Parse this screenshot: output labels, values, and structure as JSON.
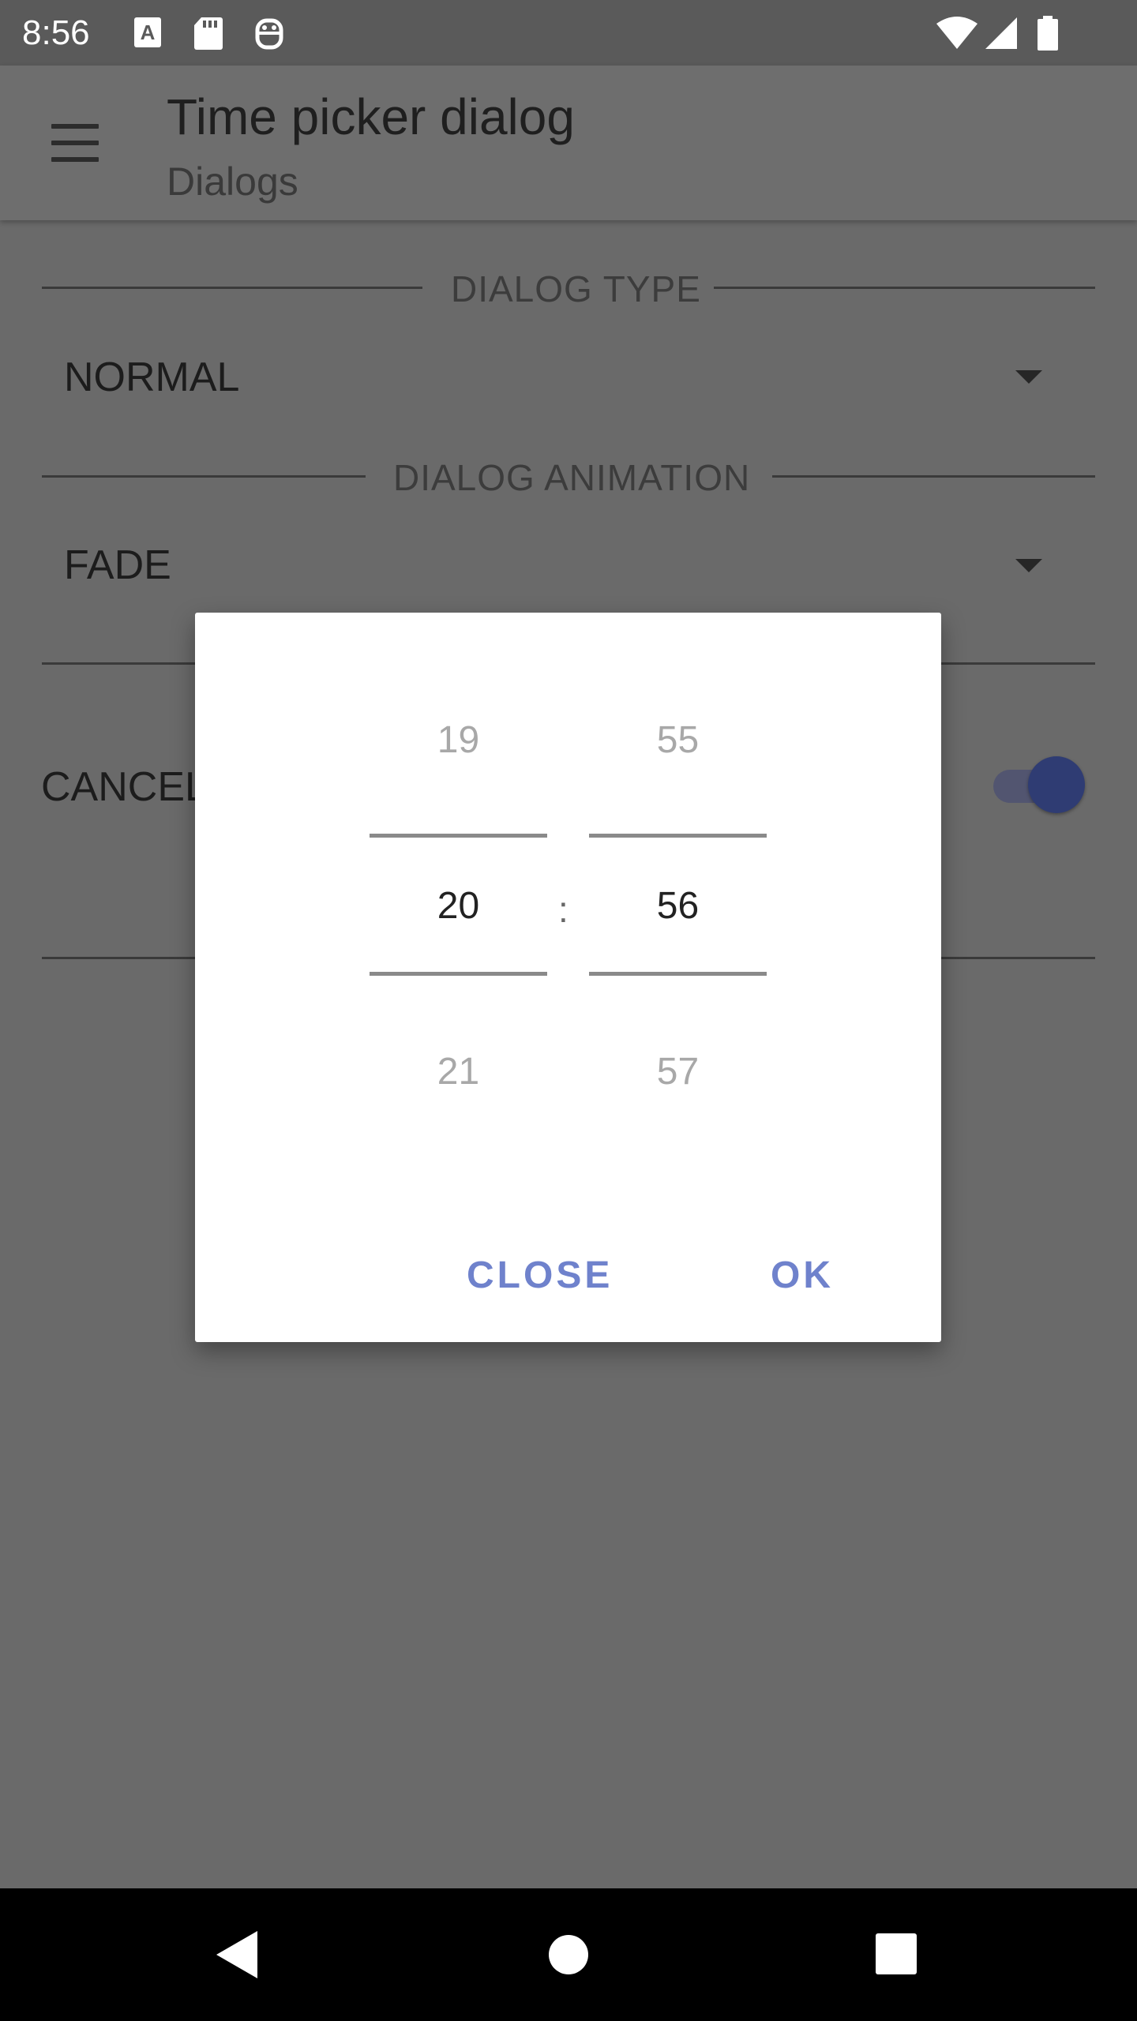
{
  "status_bar": {
    "time": "8:56",
    "icons": [
      "a-notification-icon",
      "sd-card-icon",
      "robot-icon",
      "wifi-icon",
      "signal-icon",
      "battery-icon"
    ]
  },
  "app_bar": {
    "menu_icon": "menu-icon",
    "title": "Time picker dialog",
    "subtitle": "Dialogs"
  },
  "form": {
    "dialog_type_label": "DIALOG TYPE",
    "dialog_type_value": "NORMAL",
    "dialog_animation_label": "DIALOG ANIMATION",
    "dialog_animation_value": "FADE",
    "cancelable_label": "CANCEL",
    "cancelable_toggle_on": true
  },
  "dialog": {
    "hour_prev": "19",
    "hour_selected": "20",
    "hour_next": "21",
    "separator": ":",
    "minute_prev": "55",
    "minute_selected": "56",
    "minute_next": "57",
    "close_label": "CLOSE",
    "ok_label": "OK"
  },
  "colors": {
    "accent": "#6f82cc",
    "toggle_knob": "#2f3c73",
    "scrim_background": "#6a6a6a"
  },
  "nav_bar": {
    "back_icon": "back-icon",
    "home_icon": "home-icon",
    "recents_icon": "recents-icon"
  }
}
